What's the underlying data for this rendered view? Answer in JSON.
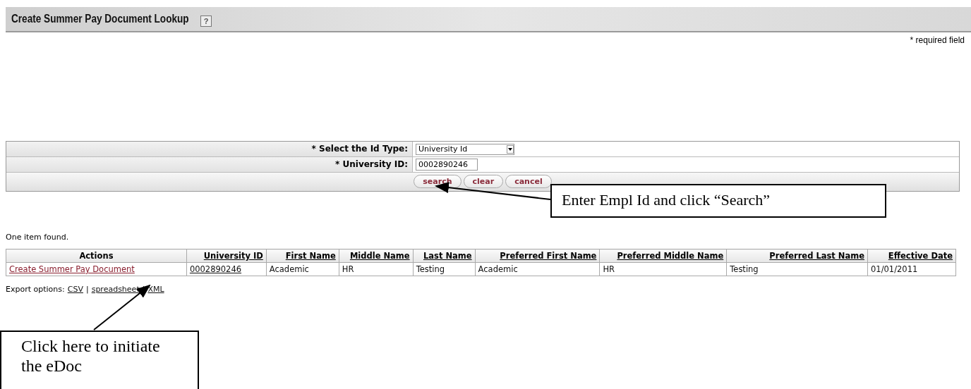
{
  "header": {
    "title": "Create Summer Pay Document Lookup",
    "help": "?"
  },
  "required_note": "* required field",
  "criteria": [
    {
      "kind": "select",
      "label": "* Select the Id Type:",
      "value": "University Id"
    },
    {
      "kind": "text",
      "label": "* University ID:",
      "value": "0002890246"
    }
  ],
  "buttons": [
    "search",
    "clear",
    "cancel"
  ],
  "result_count": "One item found.",
  "table": {
    "columns": [
      "Actions",
      "University ID",
      "First Name",
      "Middle Name",
      "Last Name",
      "Preferred First Name",
      "Preferred Middle Name",
      "Preferred Last Name",
      "Effective Date"
    ],
    "rows": [
      {
        "cells": [
          {
            "text": "Create Summer Pay Document",
            "link": true
          },
          {
            "text": "0002890246",
            "link": true
          },
          {
            "text": "Academic",
            "link": false
          },
          {
            "text": "HR",
            "link": false
          },
          {
            "text": "Testing",
            "link": false
          },
          {
            "text": "Academic",
            "link": false
          },
          {
            "text": "HR",
            "link": false
          },
          {
            "text": "Testing",
            "link": false
          },
          {
            "text": "01/01/2011",
            "link": false
          }
        ]
      }
    ]
  },
  "export": {
    "label": "Export options:",
    "separator": "|",
    "options": [
      "CSV",
      "spreadsheet",
      "XML"
    ]
  },
  "callouts": [
    "Enter Empl Id and click “Search”",
    "Click here to initiate the eDoc"
  ]
}
